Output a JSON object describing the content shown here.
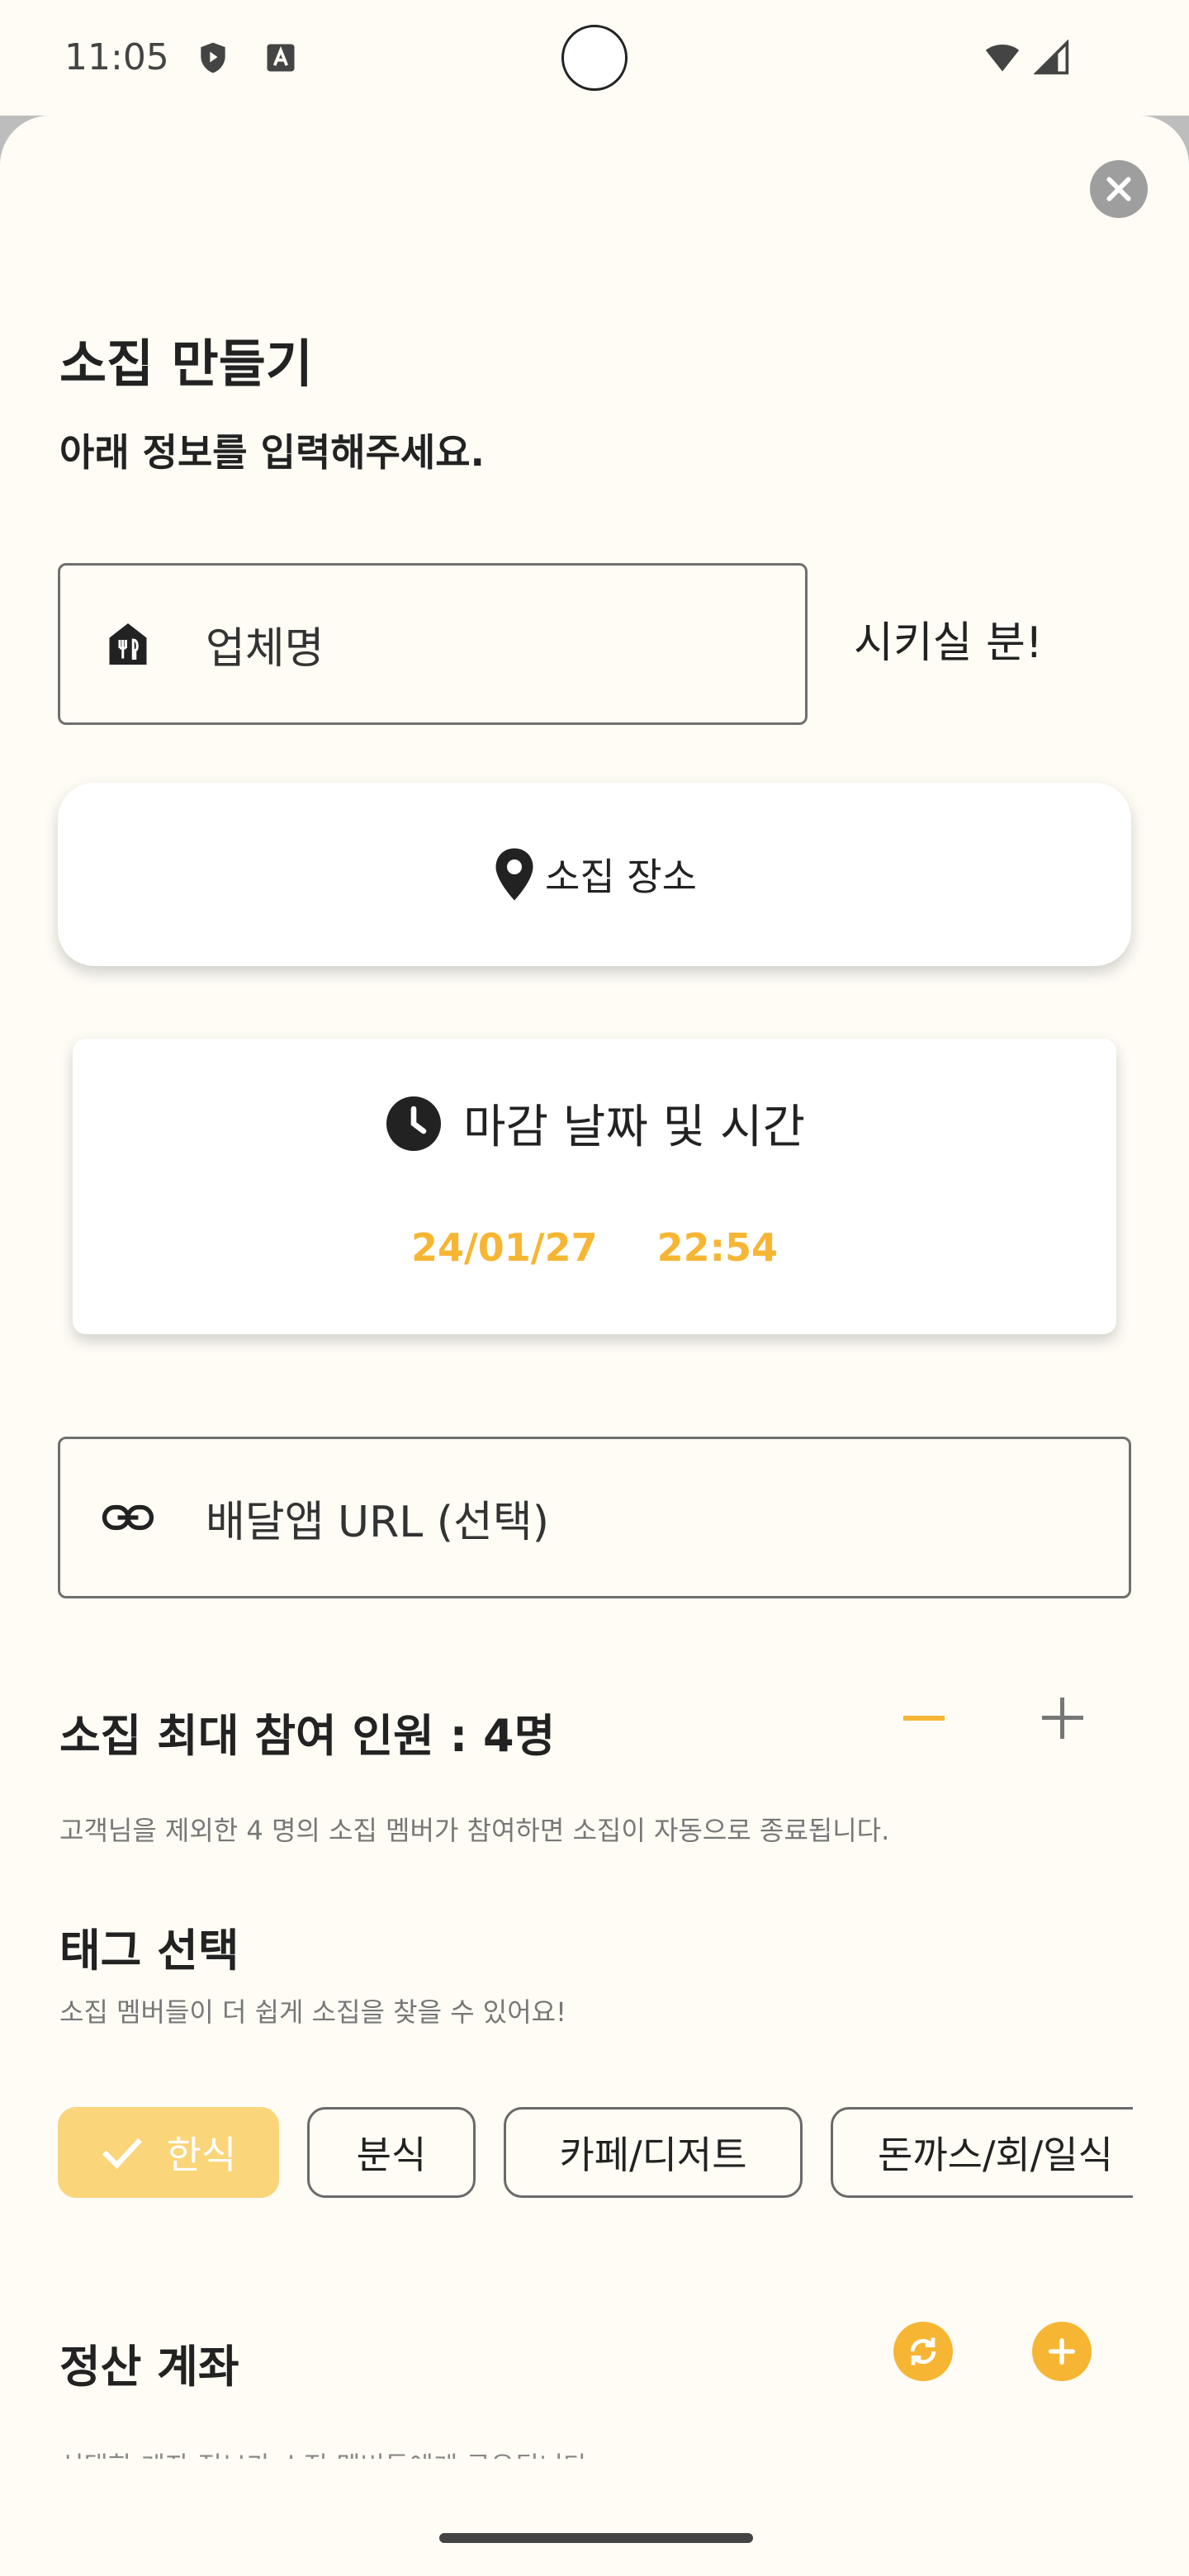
{
  "status_bar": {
    "time": "11:05"
  },
  "sheet": {
    "title": "소집 만들기",
    "subtitle": "아래 정보를 입력해주세요."
  },
  "form": {
    "store_name": {
      "placeholder": "업체명",
      "icon": "restaurant-icon"
    },
    "order_label": "시키실 분!",
    "place": {
      "label": "소집 장소",
      "icon": "location-pin-icon"
    },
    "deadline": {
      "label": "마감 날짜 및 시간",
      "date": "24/01/27",
      "time": "22:54",
      "icon": "clock-icon"
    },
    "delivery_url": {
      "placeholder": "배달앱 URL (선택)",
      "icon": "link-icon"
    }
  },
  "participants": {
    "title": "소집 최대 참여 인원 : 4명",
    "hint": "고객님을 제외한 4 명의 소집 멤버가 참여하면 소집이 자동으로 종료됩니다."
  },
  "tags": {
    "title": "태그 선택",
    "hint": "소집 멤버들이 더 쉽게 소집을 찾을 수 있어요!",
    "chips": [
      {
        "label": "한식",
        "selected": true
      },
      {
        "label": "분식",
        "selected": false
      },
      {
        "label": "카페/디저트",
        "selected": false
      },
      {
        "label": "돈까스/회/일식",
        "selected": false
      }
    ]
  },
  "account": {
    "title": "정산 계좌",
    "partial_text": "선택한 계좌 정보가 소집 멤버들에게 공유됩니다."
  },
  "colors": {
    "accent": "#f6b634",
    "chip_selected": "#fad57a",
    "background": "#fefcf5"
  }
}
